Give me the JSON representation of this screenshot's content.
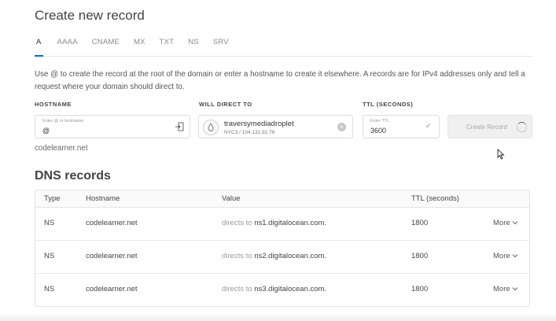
{
  "page": {
    "title": "Create new record"
  },
  "tabs": [
    {
      "label": "A",
      "active": true
    },
    {
      "label": "AAAA"
    },
    {
      "label": "CNAME"
    },
    {
      "label": "MX"
    },
    {
      "label": "TXT"
    },
    {
      "label": "NS"
    },
    {
      "label": "SRV"
    }
  ],
  "description": "Use @ to create the record at the root of the domain or enter a hostname to create it elsewhere. A records are for IPv4 addresses only and tell a request where your domain should direct to.",
  "form": {
    "hostname_label": "HOSTNAME",
    "hostname_placeholder": "Enter @ or hostname",
    "hostname_value": "@",
    "direct_label": "WILL DIRECT TO",
    "direct_name": "traversymediadroplet",
    "direct_sub": "NYC3 / 104.131.92.76",
    "ttl_label": "TTL (SECONDS)",
    "ttl_placeholder": "Enter TTL",
    "ttl_value": "3600",
    "create_button": "Create Record"
  },
  "domain": "codelearner.net",
  "dns": {
    "heading": "DNS records",
    "columns": {
      "type": "Type",
      "hostname": "Hostname",
      "value": "Value",
      "ttl": "TTL (seconds)"
    },
    "rows": [
      {
        "type": "NS",
        "hostname": "codelearner.net",
        "directs": "directs to",
        "value": "ns1.digitalocean.com.",
        "ttl": "1800",
        "more": "More"
      },
      {
        "type": "NS",
        "hostname": "codelearner.net",
        "directs": "directs to",
        "value": "ns2.digitalocean.com.",
        "ttl": "1800",
        "more": "More"
      },
      {
        "type": "NS",
        "hostname": "codelearner.net",
        "directs": "directs to",
        "value": "ns3.digitalocean.com.",
        "ttl": "1800",
        "more": "More"
      }
    ]
  },
  "icons": {
    "hostname_field": "insert-icon",
    "droplet": "droplet-icon",
    "clear": "clear-icon",
    "ttl_valid": "check-icon",
    "create_loading": "spinner-icon",
    "more": "chevron-down-icon",
    "cursor": "mouse-pointer-icon"
  },
  "colors": {
    "accent": "#0069ff"
  }
}
